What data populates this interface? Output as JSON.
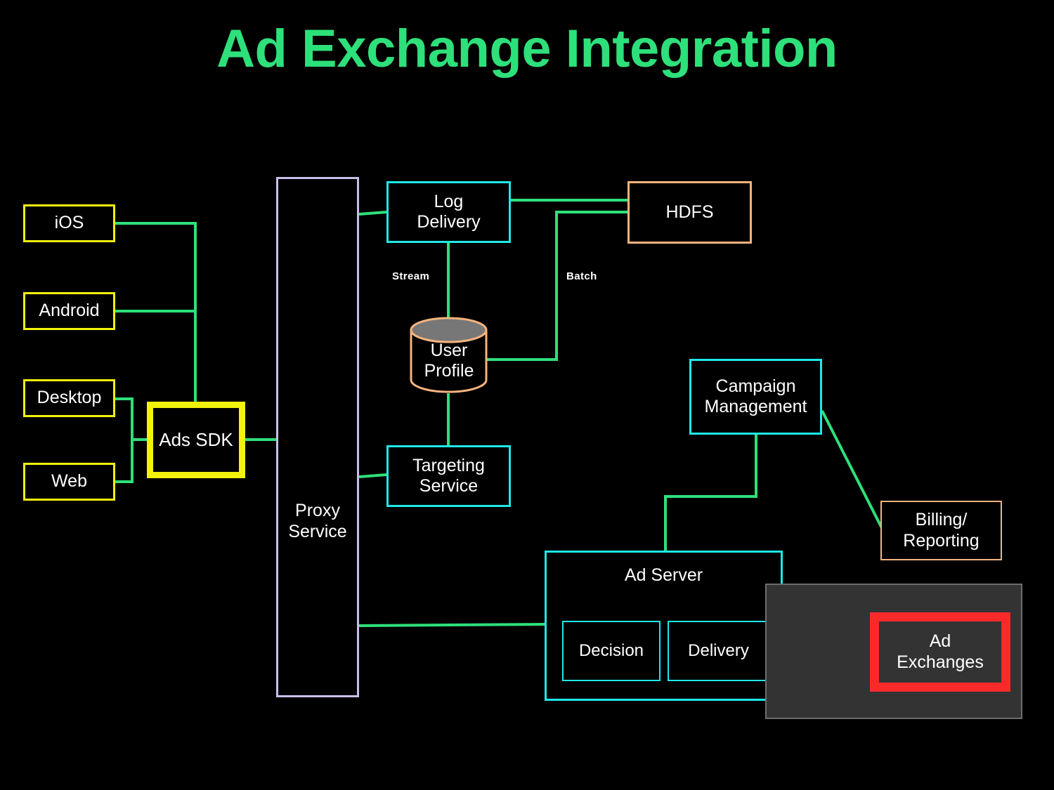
{
  "title": "Ad Exchange Integration",
  "colors": {
    "background": "#000000",
    "title_green": "#2ee07a",
    "edge_green": "#2ee07a",
    "client_yellow": "#f2f20d",
    "service_cyan": "#1fe8e8",
    "proxy_purple": "#c9bfe8",
    "storage_orange": "#f5b47e",
    "highlight_red": "#fb2a2a",
    "highlight_overlay_gray": "#333333",
    "text_white": "#ffffff"
  },
  "nodes": {
    "ios": "iOS",
    "android": "Android",
    "desktop": "Desktop",
    "web": "Web",
    "ads_sdk": "Ads SDK",
    "proxy_service": "Proxy\nService",
    "log_delivery": "Log\nDelivery",
    "targeting_service": "Targeting\nService",
    "user_profile": "User\nProfile",
    "hdfs": "HDFS",
    "campaign_management": "Campaign\nManagement",
    "billing_reporting": "Billing/\nReporting",
    "ad_server": "Ad Server",
    "decision": "Decision",
    "delivery": "Delivery",
    "ad_exchanges": "Ad\nExchanges"
  },
  "edge_labels": {
    "stream": "Stream",
    "batch": "Batch"
  },
  "chart_data": {
    "type": "diagram",
    "title": "Ad Exchange Integration",
    "nodes": [
      {
        "id": "ios",
        "label": "iOS",
        "shape": "rect",
        "border": "#f2f20d"
      },
      {
        "id": "android",
        "label": "Android",
        "shape": "rect",
        "border": "#f2f20d"
      },
      {
        "id": "desktop",
        "label": "Desktop",
        "shape": "rect",
        "border": "#f2f20d"
      },
      {
        "id": "web",
        "label": "Web",
        "shape": "rect",
        "border": "#f2f20d"
      },
      {
        "id": "ads_sdk",
        "label": "Ads SDK",
        "shape": "rect",
        "border": "#f2f20d",
        "emphasis": "thick"
      },
      {
        "id": "proxy_service",
        "label": "Proxy Service",
        "shape": "rect",
        "border": "#c9bfe8"
      },
      {
        "id": "log_delivery",
        "label": "Log Delivery",
        "shape": "rect",
        "border": "#1fe8e8"
      },
      {
        "id": "targeting_service",
        "label": "Targeting Service",
        "shape": "rect",
        "border": "#1fe8e8"
      },
      {
        "id": "user_profile",
        "label": "User Profile",
        "shape": "cylinder",
        "border": "#f5b47e"
      },
      {
        "id": "hdfs",
        "label": "HDFS",
        "shape": "rect",
        "border": "#f5b47e"
      },
      {
        "id": "campaign_management",
        "label": "Campaign Management",
        "shape": "rect",
        "border": "#1fe8e8"
      },
      {
        "id": "billing_reporting",
        "label": "Billing/ Reporting",
        "shape": "rect",
        "border": "#f5b47e"
      },
      {
        "id": "ad_server",
        "label": "Ad Server",
        "shape": "rect",
        "border": "#1fe8e8",
        "children": [
          "decision",
          "delivery"
        ]
      },
      {
        "id": "decision",
        "label": "Decision",
        "shape": "rect",
        "border": "#1fe8e8"
      },
      {
        "id": "delivery",
        "label": "Delivery",
        "shape": "rect",
        "border": "#1fe8e8"
      },
      {
        "id": "ad_exchanges",
        "label": "Ad Exchanges",
        "shape": "rect",
        "border": "#fb2a2a",
        "emphasis": "highlighted"
      }
    ],
    "edges": [
      {
        "from": "ios",
        "to": "ads_sdk",
        "label": ""
      },
      {
        "from": "android",
        "to": "ads_sdk",
        "label": ""
      },
      {
        "from": "desktop",
        "to": "ads_sdk",
        "label": ""
      },
      {
        "from": "web",
        "to": "ads_sdk",
        "label": ""
      },
      {
        "from": "ads_sdk",
        "to": "proxy_service",
        "label": ""
      },
      {
        "from": "proxy_service",
        "to": "log_delivery",
        "label": ""
      },
      {
        "from": "proxy_service",
        "to": "targeting_service",
        "label": ""
      },
      {
        "from": "proxy_service",
        "to": "ad_server",
        "label": ""
      },
      {
        "from": "log_delivery",
        "to": "hdfs",
        "label": ""
      },
      {
        "from": "log_delivery",
        "to": "user_profile",
        "label": "Stream"
      },
      {
        "from": "user_profile",
        "to": "hdfs",
        "label": "Batch"
      },
      {
        "from": "user_profile",
        "to": "targeting_service",
        "label": ""
      },
      {
        "from": "campaign_management",
        "to": "ad_server",
        "label": ""
      },
      {
        "from": "campaign_management",
        "to": "billing_reporting",
        "label": ""
      },
      {
        "from": "delivery",
        "to": "ad_exchanges",
        "label": "",
        "style": "dashed"
      }
    ]
  }
}
